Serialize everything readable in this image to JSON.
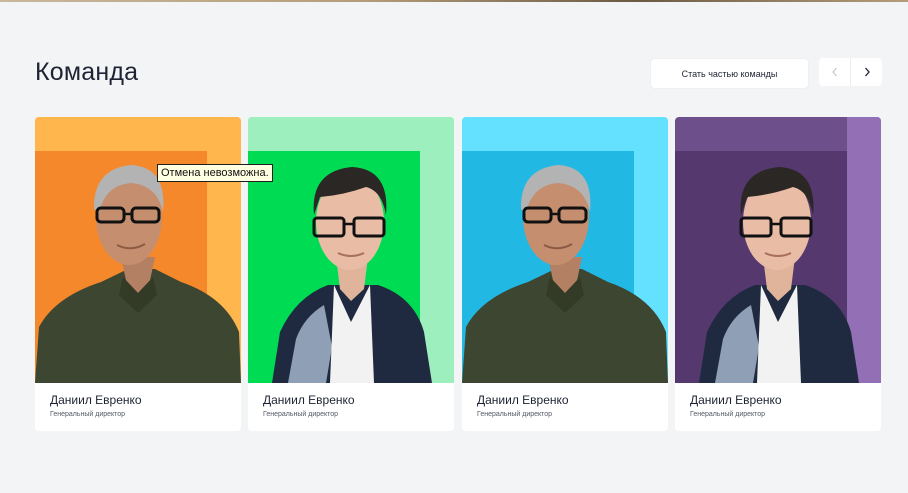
{
  "section": {
    "title": "Команда",
    "join_button": "Стать частью команды"
  },
  "nav": {
    "prev_icon": "chevron-left-icon",
    "next_icon": "chevron-right-icon"
  },
  "tooltip": {
    "text": "Отмена невозможна."
  },
  "team": [
    {
      "name": "Даниил Евренко",
      "role": "Генеральный директор",
      "colors": {
        "main": "#f5882b",
        "band": "#ffb64d"
      },
      "photo": "gray-haired-man-portrait"
    },
    {
      "name": "Даниил Евренко",
      "role": "Генеральный директор",
      "colors": {
        "main": "#00db54",
        "band": "#9df0bd"
      },
      "photo": "dark-haired-man-portrait"
    },
    {
      "name": "Даниил Евренко",
      "role": "Генеральный директор",
      "colors": {
        "main": "#21b8e3",
        "band": "#64e1ff"
      },
      "photo": "gray-haired-man-portrait"
    },
    {
      "name": "Даниил Евренко",
      "role": "Генеральный директор",
      "colors": {
        "main": "#55386e",
        "band": "#9370b5"
      },
      "photo": "dark-haired-man-portrait"
    }
  ]
}
